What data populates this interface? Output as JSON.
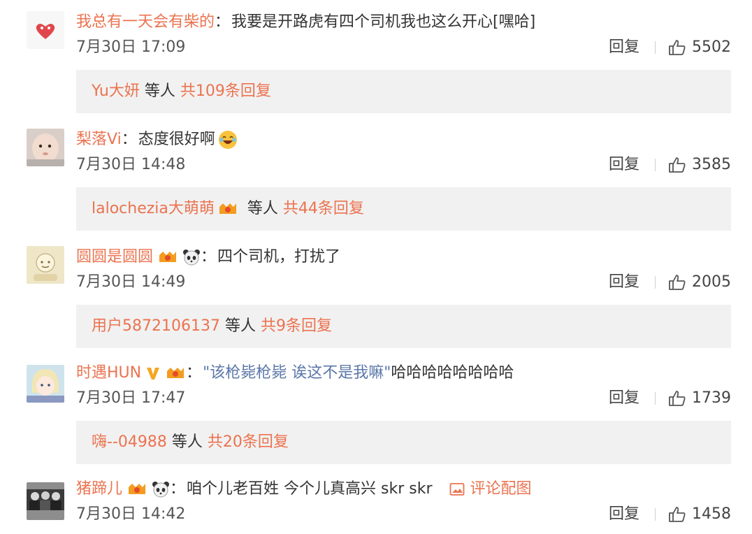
{
  "comments": [
    {
      "username": "我总有一天会有柴的",
      "colon": "：",
      "text": "我要是开路虎有四个司机我也这么开心[嘿哈]",
      "time": "7月30日 17:09",
      "reply_label": "回复",
      "likes": "5502",
      "avatar_icon": "red-heart-logo-avatar",
      "reply_summary": {
        "name": "Yu大妍",
        "tail": " 等人 ",
        "count": "共109条回复"
      }
    },
    {
      "username": "梨落Vi",
      "colon": "：",
      "text": "态度很好啊",
      "emoji_icon": "laughing-emoji-icon",
      "time": "7月30日 14:48",
      "reply_label": "回复",
      "likes": "3585",
      "avatar_icon": "baby-photo-avatar",
      "reply_summary": {
        "name": "lalochezia大萌萌",
        "tail": " 等人 ",
        "count": "共44条回复"
      }
    },
    {
      "username": "圆圆是圆圆",
      "colon": "：",
      "text": "四个司机，打扰了",
      "time": "7月30日 14:49",
      "reply_label": "回复",
      "likes": "2005",
      "avatar_icon": "cartoon-avatar",
      "reply_summary": {
        "name": "用户5872106137",
        "tail": " 等人 ",
        "count": "共9条回复"
      }
    },
    {
      "username": "时遇HUN",
      "colon": "：",
      "quote": "\"该枪毙枪毙 诶这不是我嘛\"",
      "text": "哈哈哈哈哈哈哈哈",
      "time": "7月30日 17:47",
      "reply_label": "回复",
      "likes": "1739",
      "avatar_icon": "anime-character-avatar",
      "reply_summary": {
        "name": "嗨--04988",
        "tail": " 等人 ",
        "count": "共20条回复"
      }
    },
    {
      "username": "猪蹄儿",
      "colon": "：",
      "text": "咱个儿老百姓 今个儿真高兴 skr skr",
      "pic_link": "评论配图",
      "time": "7月30日 14:42",
      "reply_label": "回复",
      "likes": "1458",
      "avatar_icon": "group-photo-avatar"
    }
  ],
  "colors": {
    "username": "#eb7350",
    "quote": "#5b77a8",
    "reply_box_bg": "#f1f1f1",
    "text": "#333333"
  }
}
